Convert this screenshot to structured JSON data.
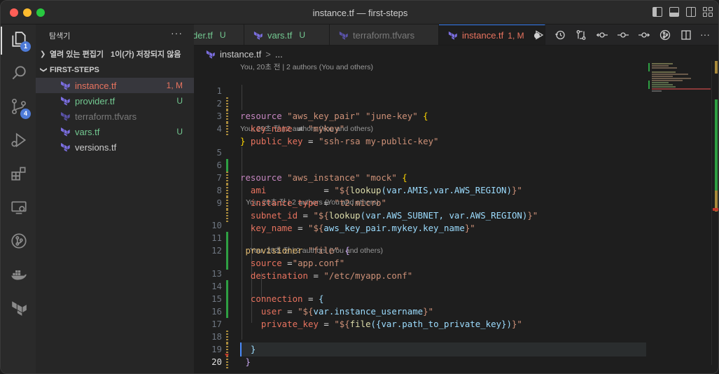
{
  "window": {
    "title": "instance.tf — first-steps"
  },
  "activity_bar": {
    "explorer_badge": "1",
    "scm_badge": "4"
  },
  "sidebar": {
    "title": "탐색기",
    "more_label": "···",
    "open_editors": {
      "label": "열려 있는 편집기",
      "unsaved": "1이(가) 저장되지 않음"
    },
    "project": {
      "label": "FIRST-STEPS"
    },
    "files": [
      {
        "name": "instance.tf",
        "status": "1, M",
        "state": "modified"
      },
      {
        "name": "provider.tf",
        "status": "U",
        "state": "untracked"
      },
      {
        "name": "terraform.tfvars",
        "status": "",
        "state": "ignored"
      },
      {
        "name": "vars.tf",
        "status": "U",
        "state": "untracked"
      },
      {
        "name": "versions.tf",
        "status": "",
        "state": "normal"
      }
    ]
  },
  "tabs": [
    {
      "name": "der.tf",
      "status": "U"
    },
    {
      "name": "vars.tf",
      "status": "U"
    },
    {
      "name": "terraform.tfvars",
      "status": ""
    },
    {
      "name": "instance.tf",
      "status": "1, M",
      "active": true
    }
  ],
  "breadcrumb": {
    "file": "instance.tf",
    "sep": ">",
    "rest": "..."
  },
  "editor": {
    "lens": [
      "You, 20초 전 | 2 authors (You and others)",
      "You, 20초 전 | 2 authors (You and others)",
      "You, 20초 전 | 2 authors (You and others)",
      "You, 20초 전 | 2 authors (You and others)"
    ],
    "line_numbers": [
      "1",
      "2",
      "3",
      "4",
      "5",
      "6",
      "7",
      "8",
      "9",
      "10",
      "11",
      "12",
      "13",
      "14",
      "15",
      "16",
      "17",
      "18",
      "19",
      "20"
    ],
    "code": {
      "l1": {
        "kw": "resource",
        "s1": "\"aws_key_pair\"",
        "s2": "\"june-key\"",
        "br": "{"
      },
      "l2": {
        "attr": "key_name",
        "eq": "=",
        "val": "\"mykey\""
      },
      "l3": {
        "attr": "public_key",
        "eq": "=",
        "val": "\"ssh-rsa my-public-key\""
      },
      "l4": {
        "br": "}"
      },
      "l5": {
        "kw": "resource",
        "s1": "\"aws_instance\"",
        "s2": "\"mock\"",
        "br": "{"
      },
      "l6": {
        "attr": "ami",
        "eq": "=",
        "q1": "\"${",
        "fn": "lookup",
        "args": "(var.AMIS,var.AWS_REGION)",
        "q2": "}\""
      },
      "l7": {
        "attr": "instance_type",
        "eq": "=",
        "val": "\"t2.micro\""
      },
      "l8": {
        "attr": "subnet_id",
        "eq": "=",
        "q1": "\"${",
        "fn": "lookup",
        "args": "(var.AWS_SUBNET, var.AWS_REGION)",
        "q2": "}\""
      },
      "l9": {
        "attr": "key_name",
        "eq": "=",
        "q1": "\"${",
        "ref": "aws_key_pair.mykey.key_name",
        "q2": "}\""
      },
      "l10": {
        "kw": "provisioner",
        "s1": "\"file\"",
        "br": "{"
      },
      "l11": {
        "attr": "source",
        "eq": "=",
        "val": "\"app.conf\""
      },
      "l12": {
        "attr": "destination",
        "eq": "=",
        "val": "\"/etc/myapp.conf\""
      },
      "l13": {
        "attr": "connection",
        "eq": "=",
        "br": "{"
      },
      "l14": {
        "attr": "user",
        "eq": "=",
        "q1": "\"${",
        "ref": "var.instance_username",
        "q2": "}\""
      },
      "l15": {
        "attr": "private_key",
        "eq": "=",
        "q1": "\"${",
        "fn": "file",
        "args": "({var.path_to_private_key})",
        "q2": "}\""
      },
      "l17": {
        "br": "}"
      },
      "l18": {
        "br": "}"
      },
      "l19": {
        "br": "}"
      }
    }
  },
  "colors": {
    "modified": "#e8735f",
    "untracked": "#73c991",
    "accent": "#4e7bd8"
  }
}
